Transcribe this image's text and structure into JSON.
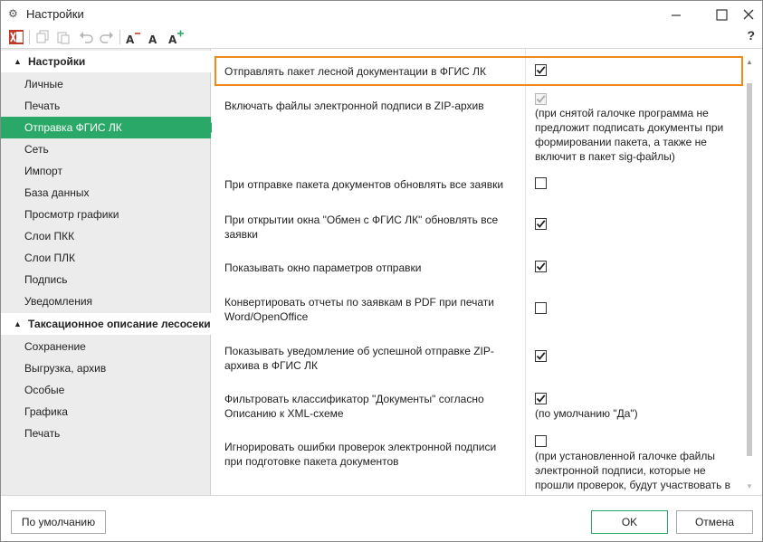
{
  "window": {
    "title": "Настройки"
  },
  "toolbar": {
    "help": "?"
  },
  "sidebar": {
    "groups": [
      {
        "label": "Настройки",
        "items": [
          "Личные",
          "Печать",
          "Отправка ФГИС ЛК",
          "Сеть",
          "Импорт",
          "База данных",
          "Просмотр графики",
          "Слои ПКК",
          "Слои ПЛК",
          "Подпись",
          "Уведомления"
        ]
      },
      {
        "label": "Таксационное описание лесосеки",
        "items": [
          "Сохранение",
          "Выгрузка, архив",
          "Особые",
          "Графика",
          "Печать"
        ]
      }
    ],
    "active_item": "Отправка ФГИС ЛК"
  },
  "options": [
    {
      "label": "Отправлять пакет лесной документации в ФГИС ЛК",
      "checked": true,
      "disabled": false,
      "note": ""
    },
    {
      "label": "Включать файлы электронной подписи в ZIP-архив",
      "checked": true,
      "disabled": true,
      "note": "(при снятой галочке программа не предложит подписать документы при формировании пакета, а также не включит в пакет sig-файлы)"
    },
    {
      "label": "При отправке пакета документов обновлять все заявки",
      "checked": false,
      "disabled": false,
      "note": ""
    },
    {
      "label": "При открытии окна \"Обмен с ФГИС ЛК\" обновлять все заявки",
      "checked": true,
      "disabled": false,
      "note": ""
    },
    {
      "label": "Показывать окно параметров отправки",
      "checked": true,
      "disabled": false,
      "note": ""
    },
    {
      "label": "Конвертировать отчеты по заявкам в PDF при печати Word/OpenOffice",
      "checked": false,
      "disabled": false,
      "note": ""
    },
    {
      "label": "Показывать уведомление об успешной отправке ZIP-архива в ФГИС ЛК",
      "checked": true,
      "disabled": false,
      "note": ""
    },
    {
      "label": "Фильтровать классификатор \"Документы\" согласно Описанию к XML-схеме",
      "checked": true,
      "disabled": false,
      "note": "(по умолчанию \"Да\")"
    },
    {
      "label": "Игнорировать ошибки проверок электронной подписи при подготовке пакета документов",
      "checked": false,
      "disabled": false,
      "note": "(при установленной галочке файлы электронной подписи, которые не прошли проверок, будут участвовать в"
    }
  ],
  "footer": {
    "default_button": "По умолчанию",
    "ok_button": "OK",
    "cancel_button": "Отмена"
  },
  "colors": {
    "accent": "#2aa867",
    "highlight": "#ef8a16"
  }
}
